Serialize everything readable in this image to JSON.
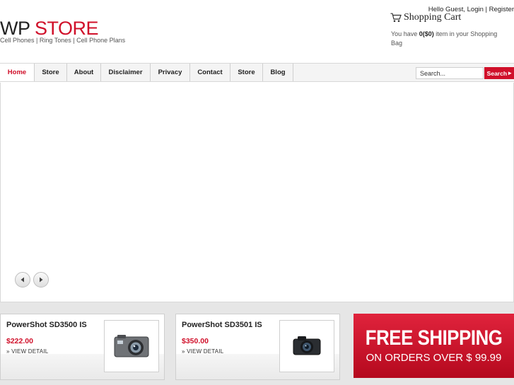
{
  "header": {
    "logo_part1": "WP",
    "logo_part2": "STORE",
    "tagline": "Cell Phones | Ring Tones | Cell Phone Plans",
    "greeting": "Hello Guest,",
    "login_label": "Login",
    "separator": "|",
    "register_label": "Register",
    "cart_title": "Shopping Cart",
    "cart_prefix": "You have",
    "cart_count": "0($0)",
    "cart_suffix": "item in your Shopping Bag"
  },
  "nav": {
    "items": [
      {
        "label": "Home",
        "active": true
      },
      {
        "label": "Store"
      },
      {
        "label": "About"
      },
      {
        "label": "Disclaimer"
      },
      {
        "label": "Privacy"
      },
      {
        "label": "Contact"
      },
      {
        "label": "Store"
      },
      {
        "label": "Blog"
      }
    ],
    "search_placeholder": "Search...",
    "search_button": "Search",
    "search_button_icon": "▸"
  },
  "products": [
    {
      "name": "PowerShot SD3500 IS",
      "price": "$222.00",
      "detail": "» VIEW DETAIL"
    },
    {
      "name": "PowerShot SD3501 IS",
      "price": "$350.00",
      "detail": "» VIEW DETAIL"
    }
  ],
  "banner": {
    "line1": "FREE SHIPPING",
    "line2": "ON ORDERS OVER $ 99.99"
  },
  "colors": {
    "accent": "#d0102a",
    "nav_bg": "#f4f4f4",
    "strip_bg": "#e6e6e6"
  },
  "icons": {
    "cart": "shopping-cart-icon",
    "prev": "arrow-left-icon",
    "next": "arrow-right-icon",
    "product_image": "camera-icon"
  }
}
